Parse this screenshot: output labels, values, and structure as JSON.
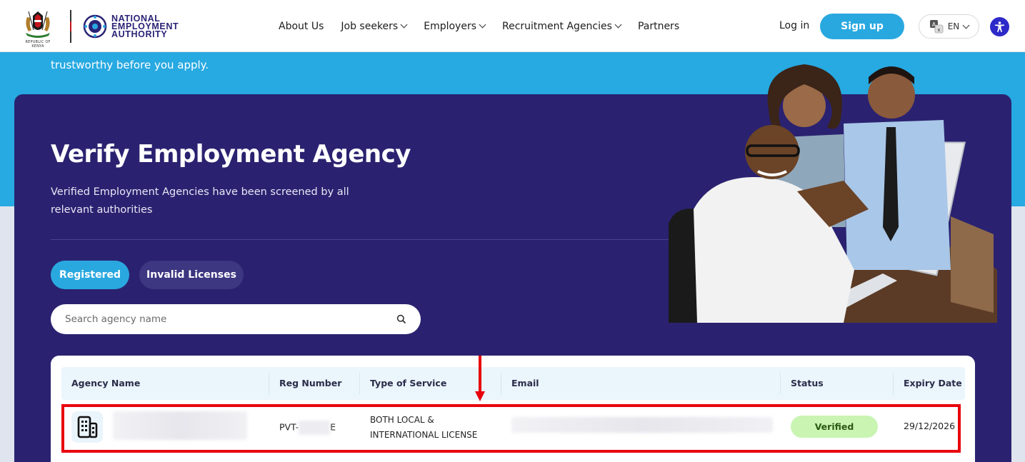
{
  "header": {
    "coat_caption": "REPUBLIC OF KENYA",
    "org_line1": "NATIONAL",
    "org_line2": "EMPLOYMENT",
    "org_line3": "AUTHORITY",
    "nav": [
      {
        "label": "About Us",
        "has_dropdown": false
      },
      {
        "label": "Job seekers",
        "has_dropdown": true
      },
      {
        "label": "Employers",
        "has_dropdown": true
      },
      {
        "label": "Recruitment Agencies",
        "has_dropdown": true
      },
      {
        "label": "Partners",
        "has_dropdown": false
      }
    ],
    "login_label": "Log in",
    "signup_label": "Sign up",
    "language": "EN"
  },
  "hero": {
    "subtitle": "trustworthy before you apply."
  },
  "main": {
    "title": "Verify Employment Agency",
    "description": "Verified Employment Agencies have been screened by all relevant authorities",
    "tabs": [
      {
        "label": "Registered",
        "active": true
      },
      {
        "label": "Invalid Licenses",
        "active": false
      }
    ],
    "search": {
      "placeholder": "Search agency name",
      "value": ""
    }
  },
  "table": {
    "columns": [
      "Agency Name",
      "Reg Number",
      "Type of Service",
      "Email",
      "Status",
      "Expiry Date"
    ],
    "rows": [
      {
        "reg_prefix": "PVT-",
        "reg_suffix": "E",
        "service_line1": "BOTH LOCAL &",
        "service_line2": "INTERNATIONAL LICENSE",
        "status": "Verified",
        "expiry": "29/12/2026"
      }
    ]
  },
  "colors": {
    "brand_blue": "#29a8e0",
    "card_purple": "#2a2270",
    "highlight_red": "#e8000d",
    "verified_green": "#c9f4b2"
  }
}
